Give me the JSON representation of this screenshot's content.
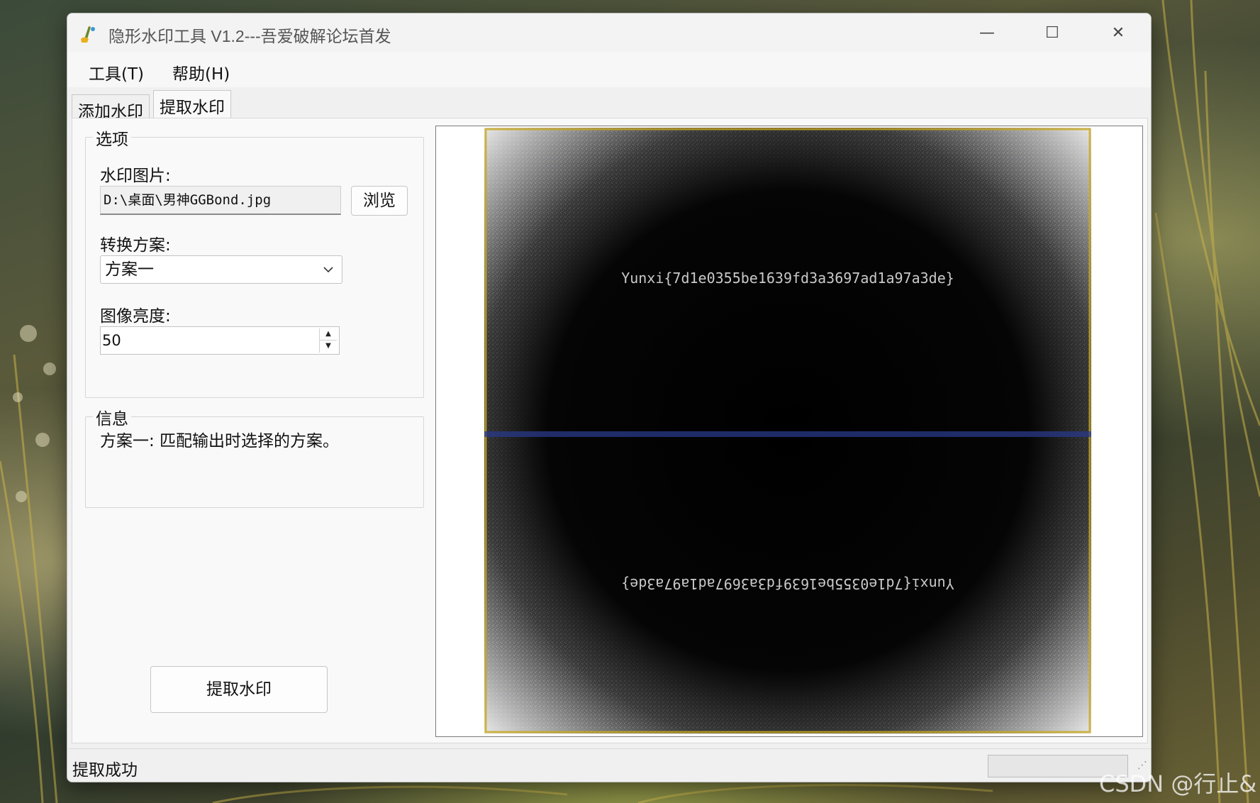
{
  "window": {
    "title": "隐形水印工具 V1.2---吾爱破解论坛首发",
    "controls": {
      "minimize": "—",
      "maximize": "☐",
      "close": "✕"
    }
  },
  "menu": {
    "tools": "工具(T)",
    "help": "帮助(H)"
  },
  "tabs": {
    "add": "添加水印",
    "extract": "提取水印",
    "active": "extract"
  },
  "options": {
    "legend": "选项",
    "watermark_image_label": "水印图片:",
    "watermark_image_path": "D:\\桌面\\男神GGBond.jpg",
    "browse_label": "浏览",
    "scheme_label": "转换方案:",
    "scheme_value": "方案一",
    "brightness_label": "图像亮度:",
    "brightness_value": "50"
  },
  "info": {
    "legend": "信息",
    "text": "方案一: 匹配输出时选择的方案。"
  },
  "extract_button": "提取水印",
  "preview": {
    "watermark_text": "Yunxi{7d1e0355be1639fd3a3697ad1a97a3de}",
    "watermark_text_mirrored": "Yunxi{7d1e0355be1639fd3a3697ad1a97a3de}"
  },
  "status": {
    "text": "提取成功",
    "progress": 0
  },
  "overlay": {
    "csdn_watermark": "CSDN @行止&"
  },
  "colors": {
    "accent": "#06b025",
    "preview_bg": "#000000",
    "preview_border_glow": "#c8a820",
    "center_line": "#2a3a8a"
  },
  "icons": {
    "app": "paint-brush-icon",
    "combo": "chevron-down-icon"
  }
}
